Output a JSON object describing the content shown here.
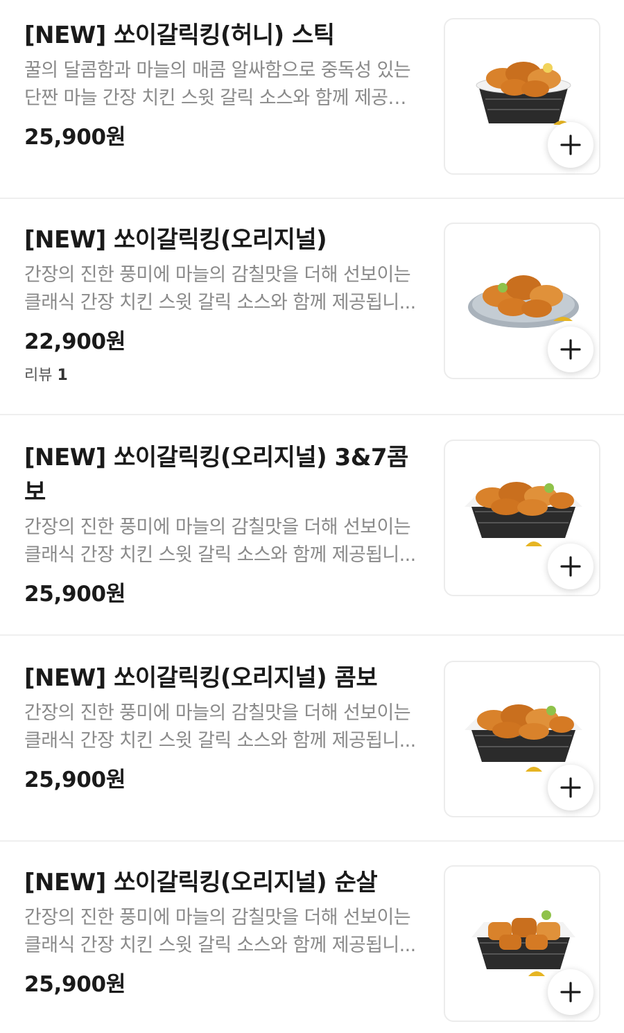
{
  "menu": {
    "items": [
      {
        "title": "[NEW] 쏘이갈릭킹(허니) 스틱",
        "desc_line1": "꿀의 달콤함과 마늘의 매콤 알싸함으로 중독성 있는",
        "desc_line2": "단짠 마늘 간장 치킨 스윗 갈릭 소스와 함께 제공됩…",
        "price": "25,900원",
        "add_icon": "plus-icon",
        "image": "chicken-basket-sticks"
      },
      {
        "title": "[NEW] 쏘이갈릭킹(오리지널)",
        "desc_line1": "간장의 진한 풍미에 마늘의 감칠맛을 더해 선보이는",
        "desc_line2": "클래식 간장 치킨 스윗 갈릭 소스와 함께 제공됩니...",
        "price": "22,900원",
        "review_label": "리뷰",
        "review_count": "1",
        "add_icon": "plus-icon",
        "image": "chicken-plate"
      },
      {
        "title_line1": "[NEW] 쏘이갈릭킹(오리지널) 3&7콤",
        "title_line2": "보",
        "desc_line1": "간장의 진한 풍미에 마늘의 감칠맛을 더해 선보이는",
        "desc_line2": "클래식 간장 치킨 스윗 갈릭 소스와 함께 제공됩니...",
        "price": "25,900원",
        "add_icon": "plus-icon",
        "image": "chicken-basket-combo"
      },
      {
        "title": "[NEW] 쏘이갈릭킹(오리지널) 콤보",
        "desc_line1": "간장의 진한 풍미에 마늘의 감칠맛을 더해 선보이는",
        "desc_line2": "클래식 간장 치킨 스윗 갈릭 소스와 함께 제공됩니...",
        "price": "25,900원",
        "add_icon": "plus-icon",
        "image": "chicken-basket-combo"
      },
      {
        "title": "[NEW] 쏘이갈릭킹(오리지널) 순살",
        "desc_line1": "간장의 진한 풍미에 마늘의 감칠맛을 더해 선보이는",
        "desc_line2": "클래식 간장 치킨 스윗 갈릭 소스와 함께 제공됩니...",
        "price": "25,900원",
        "add_icon": "plus-icon",
        "image": "chicken-basket-boneless"
      }
    ]
  },
  "colors": {
    "text_primary": "#1a1a1a",
    "text_secondary": "#8a8a8a",
    "divider": "#efefef",
    "chicken": "#d9822b",
    "basket": "#2b2b2b",
    "sauce": "#e6b422"
  }
}
